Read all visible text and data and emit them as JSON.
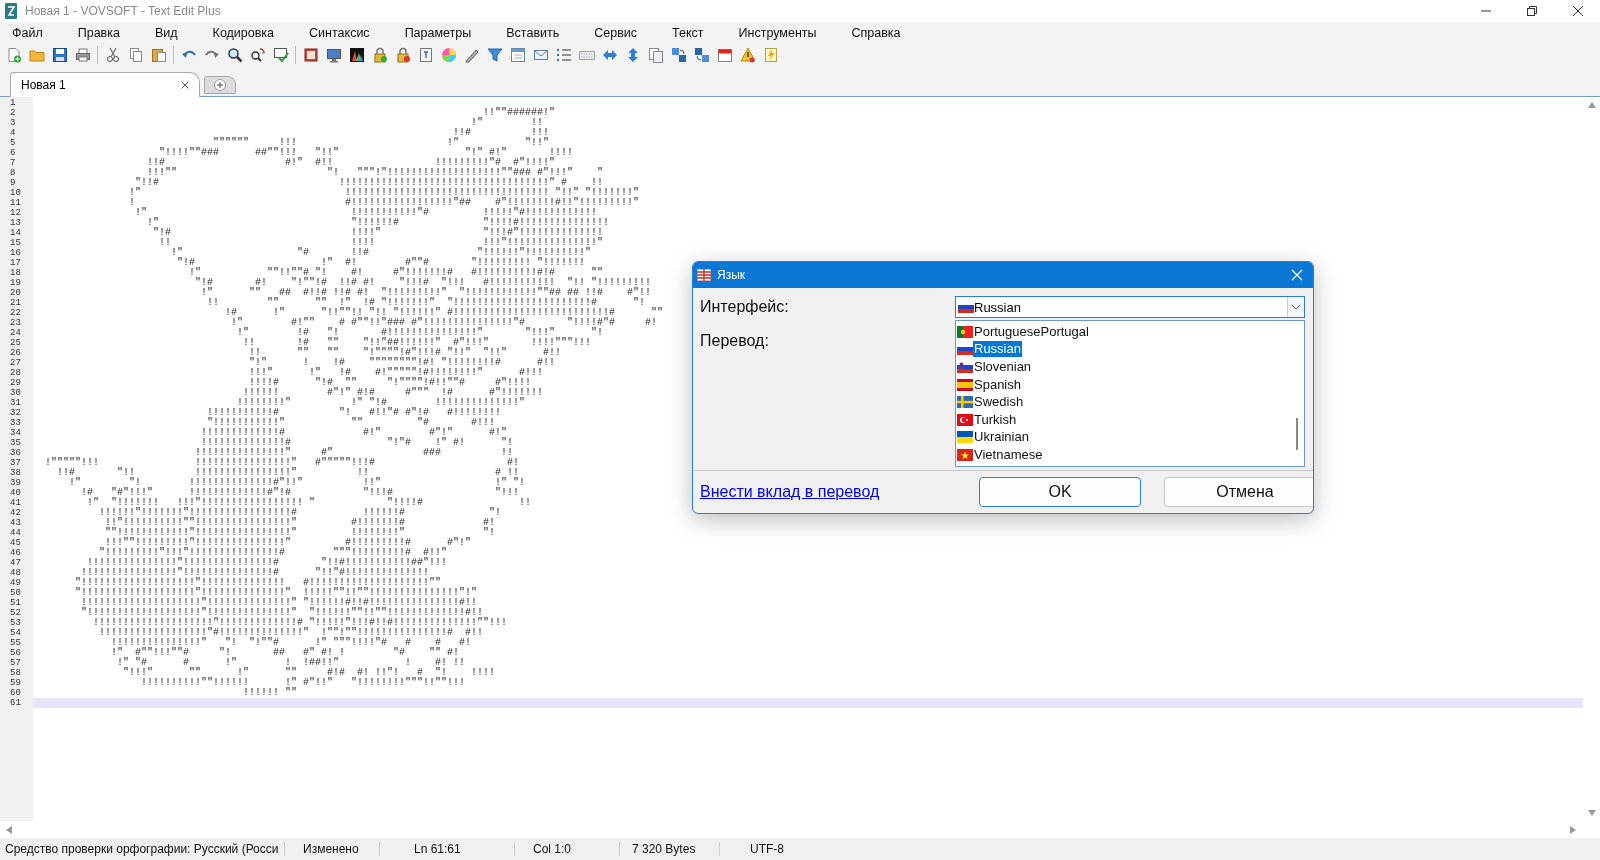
{
  "window": {
    "title": "Новая 1 - VOVSOFT - Text Edit Plus"
  },
  "menu": [
    "Файл",
    "Правка",
    "Вид",
    "Кодировка",
    "Синтаксис",
    "Параметры",
    "Вставить",
    "Сервис",
    "Текст",
    "Инструменты",
    "Справка"
  ],
  "tabs": [
    {
      "label": "Новая 1",
      "selected": true
    }
  ],
  "editor": {
    "lines": [
      {
        "number": "1",
        "current": false
      },
      {
        "number": "2",
        "text": "                                                                         !!\"\"######!\"",
        "current": false
      },
      {
        "number": "3",
        "text": "                                                                       !\"        !!",
        "current": false
      },
      {
        "number": "4",
        "text": "                                                                    !!#          !!!",
        "current": false
      },
      {
        "number": "5",
        "text": "                            \"\"\"\"\"\"     !!!                         !\"           \"!!\"",
        "current": false
      },
      {
        "number": "6",
        "text": "                   \"!!!!\"\"###      ##\"\"!!!   \"!!\"                     \"!\" #!\"       !!!!",
        "current": false
      },
      {
        "number": "7",
        "text": "                 !!#                    #!\"  #!!                 !!!!!!!!!\"#  #\"!!!!\"",
        "current": false
      },
      {
        "number": "8",
        "text": "                 !!!\"\"                         \"!   \"\"\"!\"!!!!!!!!!!!!!!!!!!!\"\"### #\"!!!\"    \"",
        "current": false
      },
      {
        "number": "9",
        "text": "               \"!!#                              !!!!!!!!!!!!!!!!!!!!!!!!!!!!!!!!!!!\" #    !!",
        "current": false
      },
      {
        "number": "10",
        "text": "              !\"                                  !!!!!!!!!!!!!!!!!!!!!!!!!!!!!!!!!! \"!!\" \"!!!!!!!\"",
        "current": false
      },
      {
        "number": "11",
        "text": "              !                                   #!!!!!!!!!!!!!!!!!\"##    #\"!!!!!!!!#!!\"!!!!!!!!!\"",
        "current": false
      },
      {
        "number": "12",
        "text": "               !\"                                  !!!!!!!!!!!\"#         !!!!!\"#!!!!!!!!!!!!",
        "current": false
      },
      {
        "number": "13",
        "text": "                 !\"                                \"!!!!!!#              \"!!!!#!!!!!!!!!!!!!!!",
        "current": false
      },
      {
        "number": "14",
        "text": "                  \"!#                              !!!!\"                 \"!!!#\"!!!!!!!!!!!!!!",
        "current": false
      },
      {
        "number": "15",
        "text": "                   !!                              !!!!                  !!!\"!!!!!!!!!!!!!!!\"",
        "current": false
      },
      {
        "number": "16",
        "text": "                     !\"                   \"#       !!#                  \"!!!!!!\"!!!!!!!!!!\"",
        "current": false
      },
      {
        "number": "17",
        "text": "                      \"!#                     !\"  #!        #\"\"#       \"!!!!!!!!! \"!!!!!!!",
        "current": false
      },
      {
        "number": "18",
        "text": "                        !\"           \"\"!!\"\"# \"!    #!     #\"!!!!!!!#   #!!!!!!!!!!#!#      \"\"",
        "current": false
      },
      {
        "number": "19",
        "text": "                         \"!#       #!    \"!\"\"!#  !!# #!    \"!!!#  \"!!!   #!!!!!!!!!!!  \"!! \"!!!!!!!!!",
        "current": false
      },
      {
        "number": "20",
        "text": "                          !\"      \"\"   ##  #!!# !!# #!  \"!!!!!!!!!\"  \"!!!!!!!!!!!!\"\"## ## !!#    #\"!!",
        "current": false
      },
      {
        "number": "21",
        "text": "                           !!        \"\"      \"\"  !\"  !# \"!!!!!!!\"  \"!!!!!!!!!!!!!!!!!!!!!!!#      \"!",
        "current": false
      },
      {
        "number": "22",
        "text": "                              !#      !\"      \"!!\"\"!! \"!! \"!!!!!!\" #!!!!!!!!!!!!!!!!!!!!!!!!!!#      \"\"",
        "current": false
      },
      {
        "number": "23",
        "text": "                               !\"        #!\"\"    # #\"\"!!\"### #\"!!!!!!!!!!!!!!!\"#       \"!!!!#\"#     #!",
        "current": false
      },
      {
        "number": "24",
        "text": "                                !\"        !#   \"!       #!!!!!!!!!!!!!!!\"       \"!!!\"      \"!",
        "current": false
      },
      {
        "number": "25",
        "text": "                                 !!       !#   \"\"    \"!!\"##!!!!!!\"  #\"!!!\"       !!!!\"\"\"!!!",
        "current": false
      },
      {
        "number": "26",
        "text": "                                  !!      \"\"   \"\"    \"!\"\"\"\"!#\"!!!# \"!!\"  \"!!\"      #!!",
        "current": false
      },
      {
        "number": "27",
        "text": "                                  \"!\"      !    !#    \"\"\"\"\"\"\"\"!#! \"!!!!!!!!#      #!!",
        "current": false
      },
      {
        "number": "28",
        "text": "                                  !!!\"      !\"   !#    #!\"\"\"\"\"!#!!!!!!!!\"      #!!!",
        "current": false
      },
      {
        "number": "29",
        "text": "                                  !!!!#      \"!#  \"\"     \"!\"\"\"\"!#!!\"\"#     #\"!!!!",
        "current": false
      },
      {
        "number": "30",
        "text": "                                 !!!!!!        #\"!\" #!#     #\"\"\"  !#      #\"!!!!!!!",
        "current": false
      },
      {
        "number": "31",
        "text": "                                !!!!!!!!\"          !\" \"!#        !!!!!!!!!!!!!!\"",
        "current": false
      },
      {
        "number": "32",
        "text": "                           !!!!!!!!!!!#          \"!   #!!\"# #\"!#   #!!!!!!!!",
        "current": false
      },
      {
        "number": "33",
        "text": "                           \"!!!!!!!!!!!\"           \"\"         \"#       #!!!",
        "current": false
      },
      {
        "number": "34",
        "text": "                          !!!!!!!!!!!!!#             #!\"        #\"!\"      #!\"",
        "current": false
      },
      {
        "number": "35",
        "text": "                          !!!!!!!!!!!!!!#                \"!\"#    !\" #!      \"!",
        "current": false
      },
      {
        "number": "36",
        "text": "                         !!!!!!!!!!!!!!!\"     #\"               ###          !!",
        "current": false
      },
      {
        "number": "37",
        "text": "!\"\"\"\"\"!!!                !!!!!!!!!!!!!!!!\"   #\"\"\"\"\"!!!#                      #!",
        "current": false
      },
      {
        "number": "38",
        "text": "  !!#       \"!!          !!!!!!!!!!!!!!!!\"          !!                     # !!",
        "current": false
      },
      {
        "number": "39",
        "text": "    !\"        \"!        !!!!!!!!!!!!!!#\"!!\"          !!\"                   !\" \"!",
        "current": false
      },
      {
        "number": "40",
        "text": "      !#   \"#\"!!!\"      !!!!!!!!!!!!!#\"!#            \"!!!#                 \"!!!",
        "current": false
      },
      {
        "number": "41",
        "text": "       !\"  \"!!!!!!!   !!!\"!!!!!!!!!!!!!!!!! \"            \"!!!!#                !!",
        "current": false
      },
      {
        "number": "42",
        "text": "         !!!!!!\"!!!!!!!\"!!!!!!!!!!!!!!!!!#           !!!!!!#              \"!",
        "current": false
      },
      {
        "number": "43",
        "text": "          !!\"!!!!!!!!!!\"\"!!!!!!!!!!!!!!!!\"         #!!!!!!!#             #!",
        "current": false
      },
      {
        "number": "44",
        "text": "          \"\"!!!!!!!!!!!!\"!!!!!!!!!!!!!!!!\"         !!!!!!!!\"             \"!",
        "current": false
      },
      {
        "number": "45",
        "text": "          !!!\"\"!!!!!!!!!\"!!!!!!!!!!!!!!!\"         #!!!!!!!!!#      #\"!\"",
        "current": false
      },
      {
        "number": "46",
        "text": "         \"!!!!!!!!!\"!!!\"!!!!!!!!!!!!!!!#        \"\"\"!!!!!!!!!#  #!!\"",
        "current": false
      },
      {
        "number": "47",
        "text": "       !!!!!!!!!!!!!!!\"!!!!!!!!!!!!!!!#       \"!!#!!!!!!!!!!!##\"!!!",
        "current": false
      },
      {
        "number": "48",
        "text": "      !!!!!!!!!!!!!!!!\"!!!!!!!!!!!!!!!#      \"!!\"#!!!!!!!!!!!!!!",
        "current": false
      },
      {
        "number": "49",
        "text": "     \"!!!!!!!!!!!!!!!!!!!\"!!!!!!!!!!!!!!   #!!!!!!!!!!!!!!!!!!!!\"\"",
        "current": false
      },
      {
        "number": "50",
        "text": "     \"!!!!!!!!!!!!!!!!!!!\"!!!!!!!!!!!!!!\"  !!!!!\"\"!!\"\"!!!!!!!!!!!!!!!\"!\"",
        "current": false
      },
      {
        "number": "51",
        "text": "      !!!!!!!!!!!!!!!!!!!!\"!!!!!!!!!!!!!!\" \"!!!!!!#!!#!!!!!!!!!!!!!!!#!!",
        "current": false
      },
      {
        "number": "52",
        "text": "      \"!!!!!!!!!!!!!!!!!!!\"!!!!!!!!!!!!!!\"  \"!!!!!!\"\"!!\"\"!!!!!!!!!!!!!#!!",
        "current": false
      },
      {
        "number": "53",
        "text": "        !!!!!!!!!!!!!!!!!!!!\"!!!!!!!!!!!!!# \"!!!!!\"!!!#!!#!!!!!!!!!!!!!!\"\"!!!",
        "current": false
      },
      {
        "number": "54",
        "text": "         !!!!!!!!!!!!!!!!!!\"#!!!!!!!!!!!!!!\"  !\"\"!\"\"!!!!!!!!!!!!!!!#  #!!",
        "current": false
      },
      {
        "number": "55",
        "text": "           !!!!!!!!!!!!!!!\"   \"!  \"!\"\"#      !\" \"\"\"!!!!\"#   #    #   #!",
        "current": false
      },
      {
        "number": "56",
        "text": "           !\"  #\"\"!!!\"\"#     \"!       ##   #\" #! !        \"#    \"\" #!",
        "current": false
      },
      {
        "number": "57",
        "text": "            !\" \"#      #      !\"        !  !##!!\"           !    #! !!",
        "current": false
      },
      {
        "number": "58",
        "text": "             \"!!!\"      \"\"      !\"      \"\"     #!#  #! !!\"!   #  \"!    !!!!",
        "current": false
      },
      {
        "number": "59",
        "text": "                !!!!!!!!!!\"\"!!!!!!      !\" #\"!!\"   \"!!!!!!!!\"\"\"!!\"\"!!!",
        "current": false
      },
      {
        "number": "60",
        "text": "                                 !!!!!! \"\"",
        "current": false
      },
      {
        "number": "61",
        "current": true
      }
    ]
  },
  "dialog": {
    "title": "Язык",
    "interface_label": "Интерфейс:",
    "interface": {
      "value": "Russian",
      "kind": "russia"
    },
    "translation_label": "Перевод:",
    "options": [
      {
        "label": "PortuguesePortugal",
        "kind": "portugal",
        "selected": false
      },
      {
        "label": "Russian",
        "kind": "russia",
        "selected": true
      },
      {
        "label": "Slovenian",
        "kind": "slovenia",
        "selected": false
      },
      {
        "label": "Spanish",
        "kind": "spain",
        "selected": false
      },
      {
        "label": "Swedish",
        "kind": "sweden",
        "selected": false
      },
      {
        "label": "Turkish",
        "kind": "turkey",
        "selected": false
      },
      {
        "label": "Ukrainian",
        "kind": "ukraine",
        "selected": false
      },
      {
        "label": "Vietnamese",
        "kind": "vietnam",
        "selected": false
      }
    ],
    "link": "Внести вклад в перевод",
    "buttons": [
      "OK",
      "Отмена"
    ]
  },
  "status_bar": [
    "Средство проверки орфографии: Русский (Росси",
    "Изменено",
    "Ln 61:61",
    "Col 1:0",
    "7 320 Bytes",
    "UTF-8"
  ]
}
